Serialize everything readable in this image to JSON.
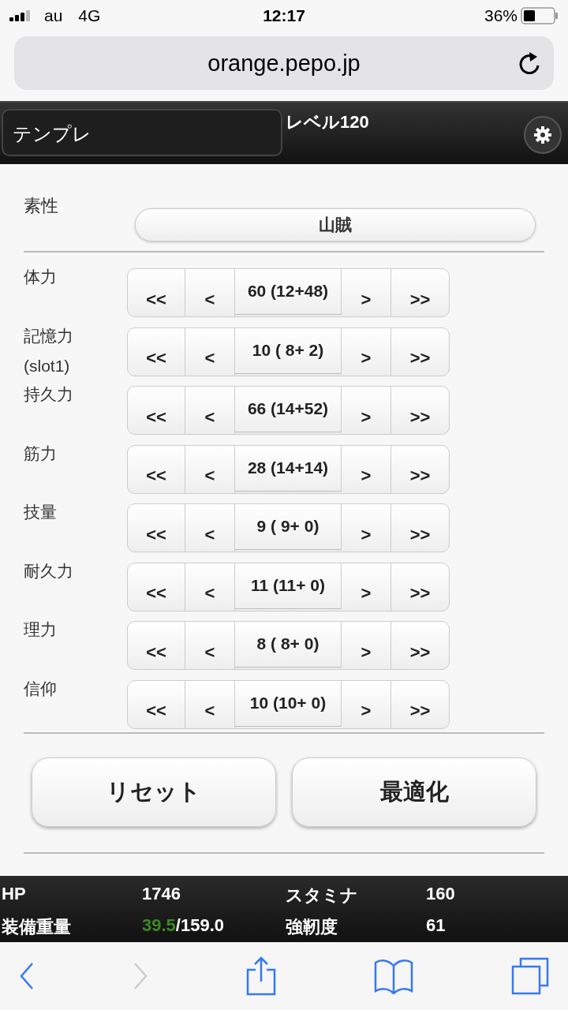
{
  "status_bar": {
    "carrier": "au",
    "network": "4G",
    "time": "12:17",
    "battery": "36%"
  },
  "browser": {
    "url": "orange.pepo.jp",
    "nav": [
      {
        "kind": "back",
        "disabled": false
      },
      {
        "kind": "forward",
        "disabled": true
      },
      {
        "kind": "share",
        "disabled": false
      },
      {
        "kind": "bookmarks",
        "disabled": false
      },
      {
        "kind": "tabs",
        "disabled": false
      }
    ]
  },
  "header": {
    "template": "テンプレ",
    "level": "レベル120"
  },
  "origin": {
    "label": "素性",
    "value": "山賊"
  },
  "stats": [
    {
      "label": "体力",
      "value": "60 (12+48)",
      "buttons": [
        "<<",
        "<",
        ">",
        ">>"
      ]
    },
    {
      "label": "記憶力",
      "sublabel": "(slot1)",
      "value": "10 ( 8+ 2)",
      "buttons": [
        "<<",
        "<",
        ">",
        ">>"
      ]
    },
    {
      "label": "持久力",
      "value": "66 (14+52)",
      "buttons": [
        "<<",
        "<",
        ">",
        ">>"
      ]
    },
    {
      "label": "筋力",
      "value": "28 (14+14)",
      "buttons": [
        "<<",
        "<",
        ">",
        ">>"
      ]
    },
    {
      "label": "技量",
      "value": "9 ( 9+ 0)",
      "buttons": [
        "<<",
        "<",
        ">",
        ">>"
      ]
    },
    {
      "label": "耐久力",
      "value": "11 (11+ 0)",
      "buttons": [
        "<<",
        "<",
        ">",
        ">>"
      ]
    },
    {
      "label": "理力",
      "value": "8 ( 8+ 0)",
      "buttons": [
        "<<",
        "<",
        ">",
        ">>"
      ]
    },
    {
      "label": "信仰",
      "value": "10 (10+ 0)",
      "buttons": [
        "<<",
        "<",
        ">",
        ">>"
      ]
    }
  ],
  "actions": [
    "リセット",
    "最適化"
  ],
  "summary": [
    {
      "label": "HP",
      "value": "1746"
    },
    {
      "label": "スタミナ",
      "value": "160"
    },
    {
      "label": "装備重量",
      "value": "39.5",
      "value_extra": "/159.0"
    },
    {
      "label": "強靭度",
      "value": "61"
    }
  ]
}
